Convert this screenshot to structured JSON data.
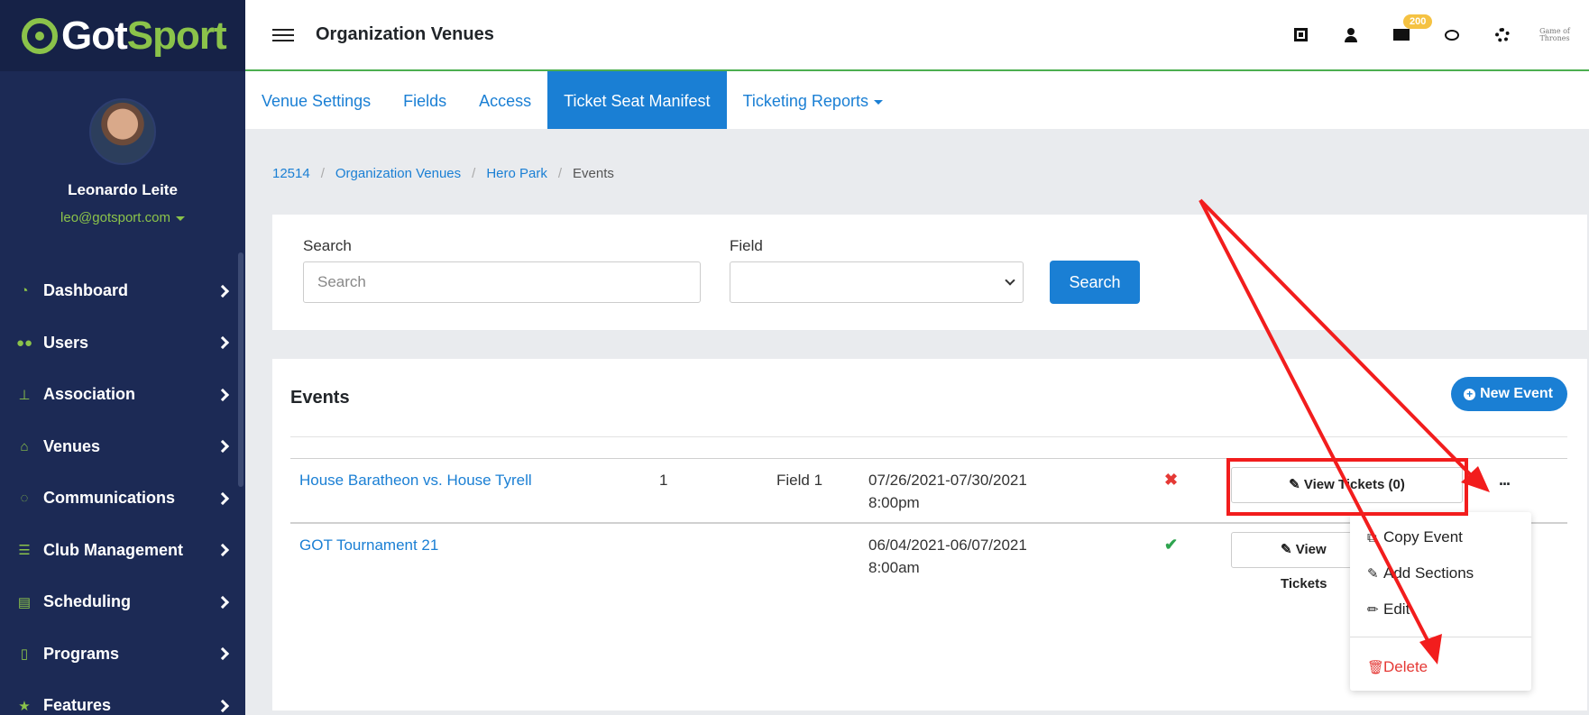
{
  "brand": {
    "part1": "Got",
    "part2": "Sport"
  },
  "profile": {
    "name": "Leonardo Leite",
    "email": "leo@gotsport.com"
  },
  "sidebar": {
    "items": [
      {
        "label": "Dashboard",
        "icon": "gauge-icon"
      },
      {
        "label": "Users",
        "icon": "users-icon"
      },
      {
        "label": "Association",
        "icon": "sitemap-icon"
      },
      {
        "label": "Venues",
        "icon": "home-icon"
      },
      {
        "label": "Communications",
        "icon": "comments-icon"
      },
      {
        "label": "Club Management",
        "icon": "list-icon"
      },
      {
        "label": "Scheduling",
        "icon": "calendar-icon"
      },
      {
        "label": "Programs",
        "icon": "file-icon"
      },
      {
        "label": "Features",
        "icon": "star-icon"
      }
    ]
  },
  "header": {
    "title": "Organization Venues",
    "message_count": "200",
    "corner_logo": "Game of Thrones"
  },
  "tabs": [
    {
      "label": "Venue Settings"
    },
    {
      "label": "Fields"
    },
    {
      "label": "Access"
    },
    {
      "label": "Ticket Seat Manifest",
      "active": true
    },
    {
      "label": "Ticketing Reports",
      "dropdown": true
    }
  ],
  "breadcrumb": [
    "12514",
    "Organization Venues",
    "Hero Park",
    "Events"
  ],
  "search": {
    "search_label": "Search",
    "search_placeholder": "Search",
    "field_label": "Field",
    "field_value": "",
    "button_label": "Search"
  },
  "events": {
    "title": "Events",
    "new_button": "New Event",
    "rows": [
      {
        "name": "House Baratheon vs. House Tyrell",
        "count": "1",
        "field": "Field 1",
        "dates": "07/26/2021-07/30/2021",
        "time": "8:00pm",
        "status": "inactive",
        "view_label": "View Tickets (0)",
        "more": "..."
      },
      {
        "name": "GOT Tournament 21",
        "count": "",
        "field": "",
        "dates": "06/04/2021-06/07/2021",
        "time": "8:00am",
        "status": "active",
        "view_label": "View Tickets",
        "more": "..."
      }
    ]
  },
  "menu": {
    "items": [
      {
        "label": "Copy Event",
        "icon": "copy-icon"
      },
      {
        "label": "Add Sections",
        "icon": "edit-icon"
      },
      {
        "label": "Edit",
        "icon": "pencil-icon"
      },
      {
        "label": "Delete",
        "icon": "trash-icon"
      }
    ]
  },
  "colors": {
    "primary": "#1a7fd4",
    "sidebar": "#1c2a55",
    "accent": "#8bc34a",
    "annotation": "#f21d1d",
    "danger": "#e53935",
    "success": "#2ea44f"
  }
}
